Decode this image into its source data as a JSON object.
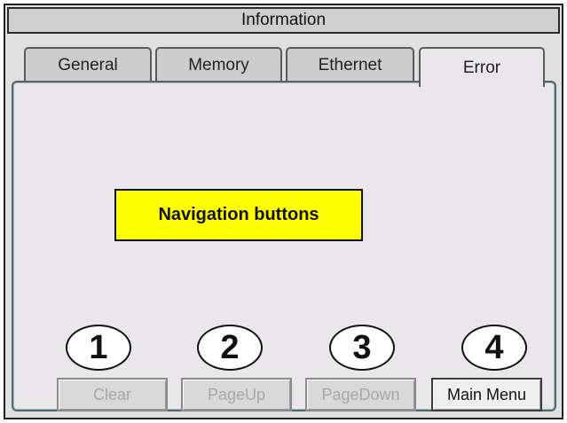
{
  "window": {
    "title": "Information"
  },
  "tabs": [
    {
      "label": "General"
    },
    {
      "label": "Memory"
    },
    {
      "label": "Ethernet"
    },
    {
      "label": "Error",
      "active": true
    }
  ],
  "callout": {
    "text": "Navigation buttons",
    "color": "#ffff00"
  },
  "markers": [
    "1",
    "2",
    "3",
    "4"
  ],
  "buttons": [
    {
      "label": "Clear",
      "enabled": false
    },
    {
      "label": "PageUp",
      "enabled": false
    },
    {
      "label": "PageDown",
      "enabled": false
    },
    {
      "label": "Main Menu",
      "enabled": true
    }
  ]
}
